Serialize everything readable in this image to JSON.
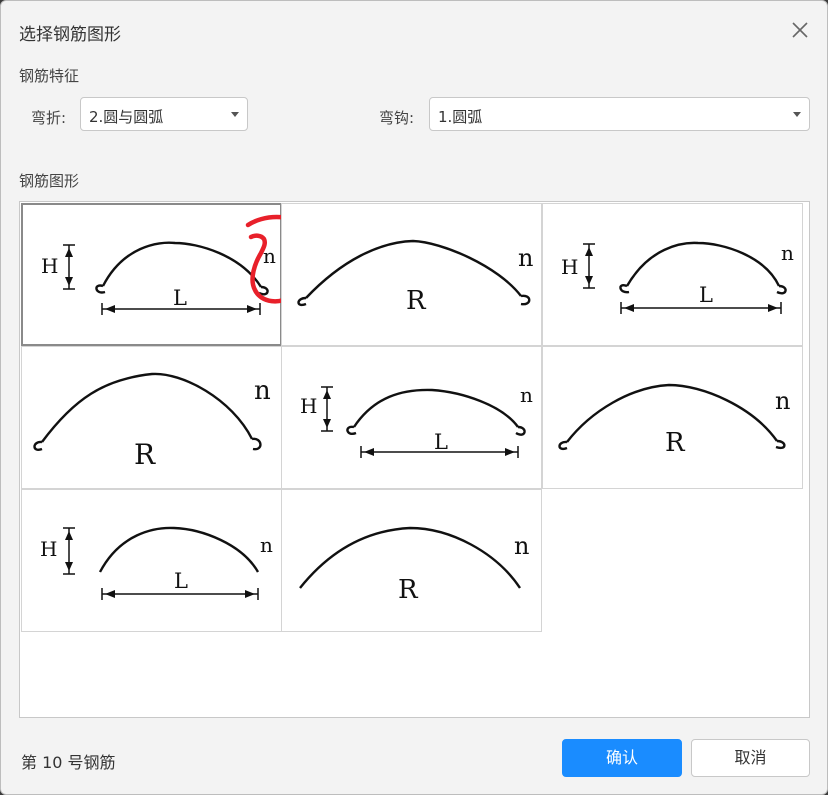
{
  "dialog": {
    "title": "选择钢筋图形",
    "close_icon": "close-icon"
  },
  "features": {
    "section_label": "钢筋特征",
    "bend_label": "弯折:",
    "bend_value": "2.圆与圆弧",
    "hook_label": "弯钩:",
    "hook_value": "1.圆弧"
  },
  "shapes": {
    "section_label": "钢筋图形",
    "items": [
      {
        "label_h": "H",
        "label_l": "L",
        "label_n": "n"
      },
      {
        "label_r": "R",
        "label_n": "n"
      },
      {
        "label_h": "H",
        "label_l": "L",
        "label_n": "n"
      },
      {
        "label_r": "R",
        "label_n": "n"
      },
      {
        "label_h": "H",
        "label_l": "L",
        "label_n": "n"
      },
      {
        "label_r": "R",
        "label_n": "n"
      },
      {
        "label_h": "H",
        "label_l": "L",
        "label_n": "n"
      },
      {
        "label_r": "R",
        "label_n": "n"
      }
    ]
  },
  "footer": {
    "status": "第 10 号钢筋",
    "confirm_label": "确认",
    "cancel_label": "取消"
  },
  "colors": {
    "primary": "#1a8cff",
    "annotation": "#e8202a"
  }
}
